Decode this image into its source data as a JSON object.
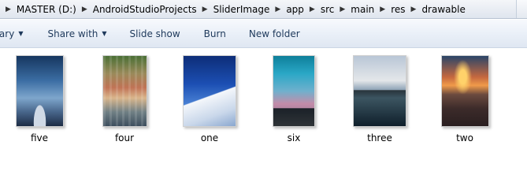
{
  "address": {
    "crumbs": [
      "MASTER (D:)",
      "AndroidStudioProjects",
      "SliderImage",
      "app",
      "src",
      "main",
      "res",
      "drawable"
    ]
  },
  "toolbar": {
    "library_label": "rary",
    "share_label": "Share with",
    "slideshow_label": "Slide show",
    "burn_label": "Burn",
    "newfolder_label": "New folder"
  },
  "files": [
    {
      "name": "five",
      "icon": "image-thumbnail-icon"
    },
    {
      "name": "four",
      "icon": "image-thumbnail-icon"
    },
    {
      "name": "one",
      "icon": "image-thumbnail-icon"
    },
    {
      "name": "six",
      "icon": "image-thumbnail-icon"
    },
    {
      "name": "three",
      "icon": "image-thumbnail-icon"
    },
    {
      "name": "two",
      "icon": "image-thumbnail-icon"
    }
  ],
  "colors": {
    "toolbar_text": "#1e395b",
    "toolbar_bg": "#eaf0f8"
  }
}
